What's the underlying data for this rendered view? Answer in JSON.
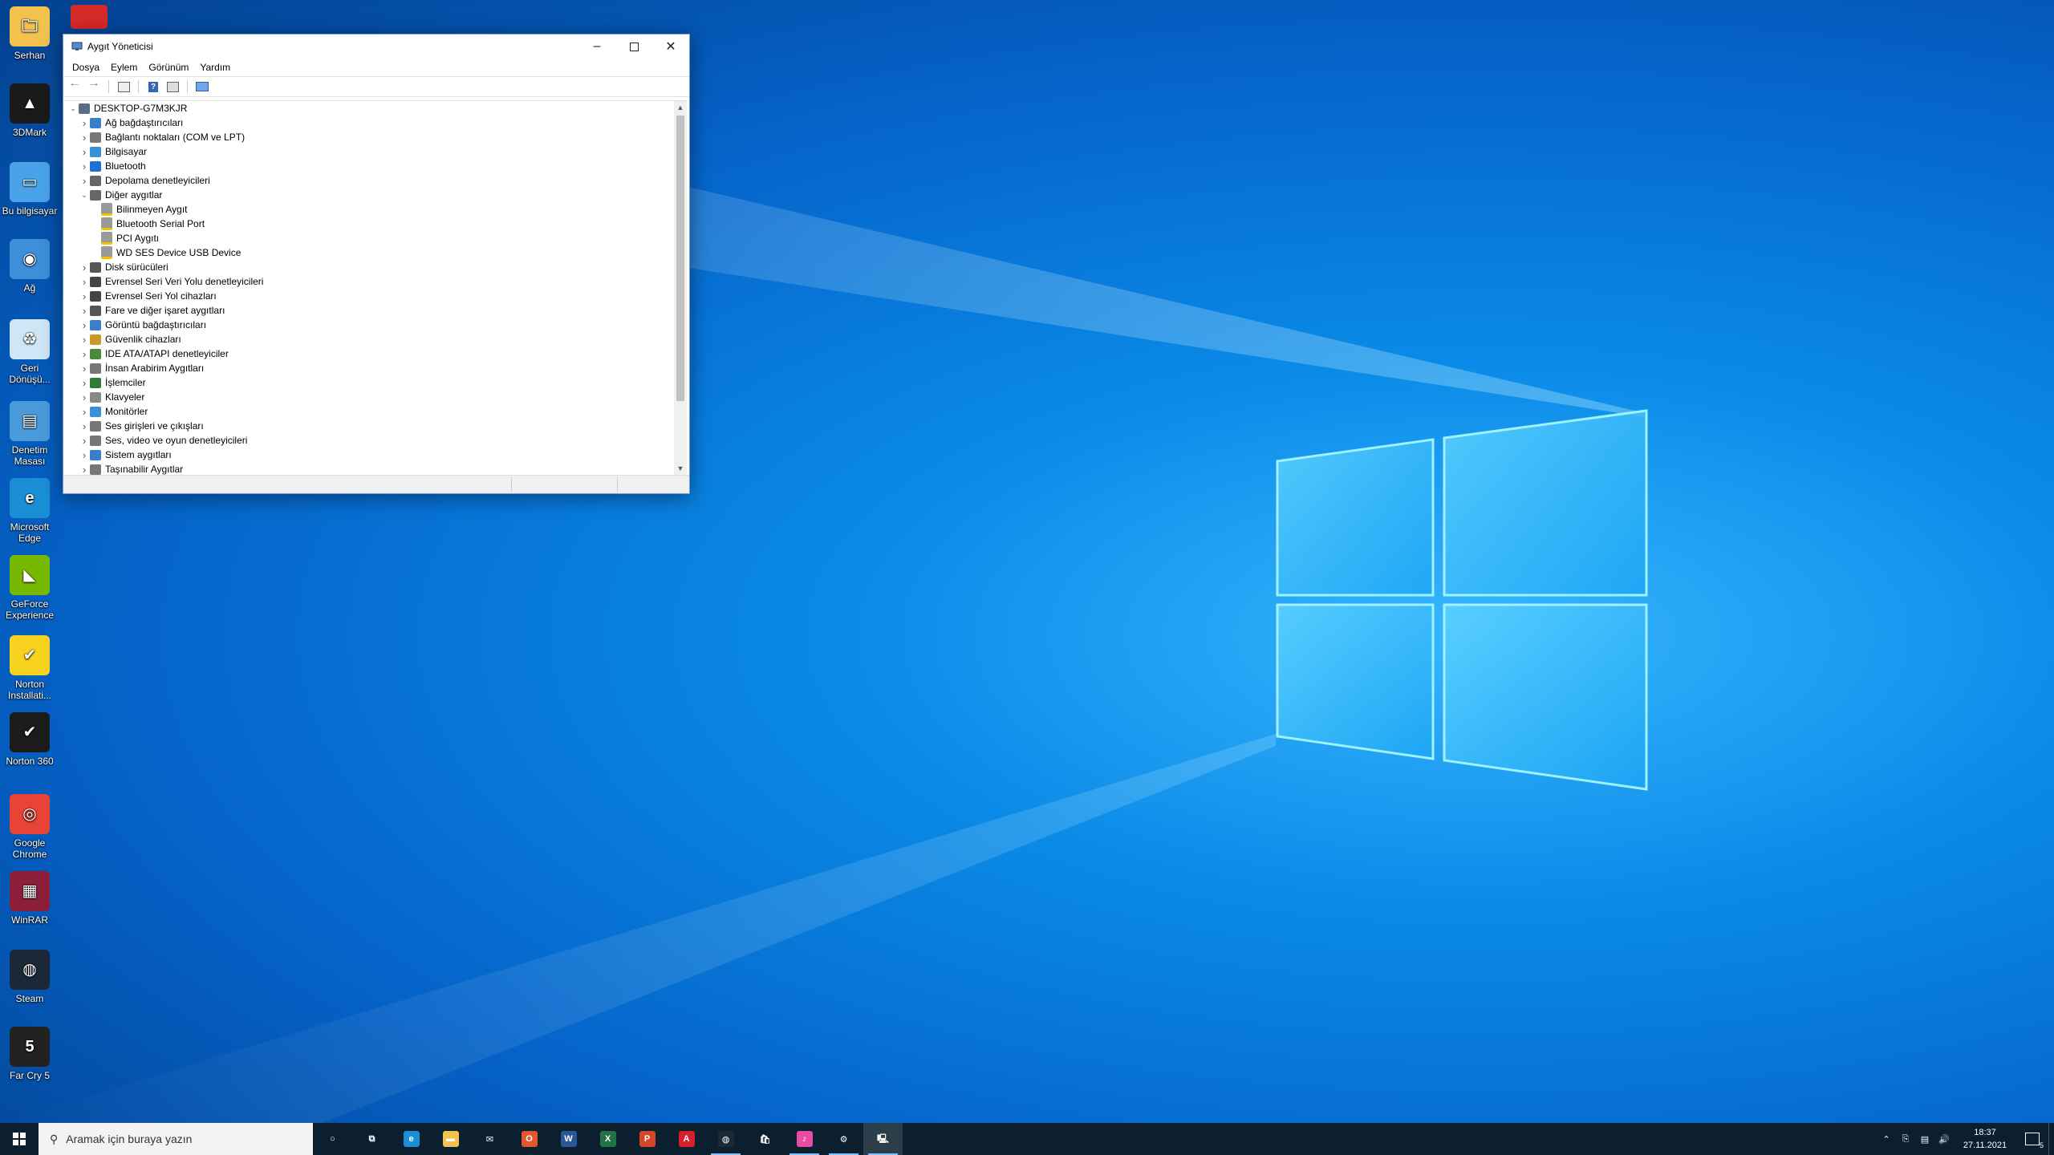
{
  "desktop": {
    "icons": [
      {
        "label": "Serhan",
        "color": "#f2c14e",
        "glyph": "🗀"
      },
      {
        "label": "3DMark",
        "color": "#1a1a1a",
        "glyph": "▲"
      },
      {
        "label": "Bu bilgisayar",
        "color": "#4aa3e8",
        "glyph": "▭"
      },
      {
        "label": "Ağ",
        "color": "#3c8fd8",
        "glyph": "◉"
      },
      {
        "label": "Geri Dönüşü...",
        "color": "#cfe6f7",
        "glyph": "♻"
      },
      {
        "label": "Denetim Masası",
        "color": "#4a9bdc",
        "glyph": "▤"
      },
      {
        "label": "Microsoft Edge",
        "color": "#1a8fd6",
        "glyph": "e"
      },
      {
        "label": "GeForce Experience",
        "color": "#76b900",
        "glyph": "◣"
      },
      {
        "label": "Norton Installati...",
        "color": "#f7d21e",
        "glyph": "✔"
      },
      {
        "label": "Norton 360",
        "color": "#1b1b1b",
        "glyph": "✔"
      },
      {
        "label": "Google Chrome",
        "color": "#e84335",
        "glyph": "◎"
      },
      {
        "label": "WinRAR",
        "color": "#8b1f3a",
        "glyph": "▦"
      },
      {
        "label": "Steam",
        "color": "#1b2838",
        "glyph": "◍"
      },
      {
        "label": "Far Cry 5",
        "color": "#222222",
        "glyph": "5"
      }
    ],
    "partial_icon_color": "#d42a2a"
  },
  "window": {
    "title": "Aygıt Yöneticisi",
    "menu": [
      "Dosya",
      "Eylem",
      "Görünüm",
      "Yardım"
    ],
    "tree": {
      "root": "DESKTOP-G7M3KJR",
      "categories": [
        {
          "label": "Ağ bağdaştırıcıları",
          "expanded": false,
          "icon_color": "#3a7fc9"
        },
        {
          "label": "Bağlantı noktaları (COM ve LPT)",
          "expanded": false,
          "icon_color": "#777777"
        },
        {
          "label": "Bilgisayar",
          "expanded": false,
          "icon_color": "#3a8fd9"
        },
        {
          "label": "Bluetooth",
          "expanded": false,
          "icon_color": "#1e6fd6"
        },
        {
          "label": "Depolama denetleyicileri",
          "expanded": false,
          "icon_color": "#666666"
        },
        {
          "label": "Diğer aygıtlar",
          "expanded": true,
          "icon_color": "#666666",
          "children": [
            "Bilinmeyen Aygıt",
            "Bluetooth Serial Port",
            "PCI Aygıtı",
            "WD SES Device USB Device"
          ]
        },
        {
          "label": "Disk sürücüleri",
          "expanded": false,
          "icon_color": "#555555"
        },
        {
          "label": "Evrensel Seri Veri Yolu denetleyicileri",
          "expanded": false,
          "icon_color": "#444444"
        },
        {
          "label": "Evrensel Seri Yol cihazları",
          "expanded": false,
          "icon_color": "#444444"
        },
        {
          "label": "Fare ve diğer işaret aygıtları",
          "expanded": false,
          "icon_color": "#555555"
        },
        {
          "label": "Görüntü bağdaştırıcıları",
          "expanded": false,
          "icon_color": "#3a7fc9"
        },
        {
          "label": "Güvenlik cihazları",
          "expanded": false,
          "icon_color": "#c79a2b"
        },
        {
          "label": "IDE ATA/ATAPI denetleyiciler",
          "expanded": false,
          "icon_color": "#4a8a3a"
        },
        {
          "label": "İnsan Arabirim Aygıtları",
          "expanded": false,
          "icon_color": "#777777"
        },
        {
          "label": "İşlemciler",
          "expanded": false,
          "icon_color": "#2e7d32"
        },
        {
          "label": "Klavyeler",
          "expanded": false,
          "icon_color": "#888888"
        },
        {
          "label": "Monitörler",
          "expanded": false,
          "icon_color": "#3a8fd9"
        },
        {
          "label": "Ses girişleri ve çıkışları",
          "expanded": false,
          "icon_color": "#777777"
        },
        {
          "label": "Ses, video ve oyun denetleyicileri",
          "expanded": false,
          "icon_color": "#777777"
        },
        {
          "label": "Sistem aygıtları",
          "expanded": false,
          "icon_color": "#3a7fc9"
        },
        {
          "label": "Taşınabilir Aygıtlar",
          "expanded": false,
          "icon_color": "#777777"
        }
      ]
    }
  },
  "taskbar": {
    "search_placeholder": "Aramak için buraya yazın",
    "apps": [
      {
        "name": "cortana",
        "color": "transparent",
        "glyph": "○"
      },
      {
        "name": "task-view",
        "color": "transparent",
        "glyph": "⧉"
      },
      {
        "name": "edge",
        "color": "#1a8fd6",
        "glyph": "e"
      },
      {
        "name": "file-explorer",
        "color": "#f2c14e",
        "glyph": "▬"
      },
      {
        "name": "mail",
        "color": "transparent",
        "glyph": "✉"
      },
      {
        "name": "office",
        "color": "#e4572e",
        "glyph": "O"
      },
      {
        "name": "word",
        "color": "#2b579a",
        "glyph": "W"
      },
      {
        "name": "excel",
        "color": "#217346",
        "glyph": "X"
      },
      {
        "name": "powerpoint",
        "color": "#d24726",
        "glyph": "P"
      },
      {
        "name": "acrobat",
        "color": "#d4202c",
        "glyph": "A"
      },
      {
        "name": "steam",
        "color": "#1b2838",
        "glyph": "◍"
      },
      {
        "name": "store",
        "color": "transparent",
        "glyph": "🛍"
      },
      {
        "name": "itunes",
        "color": "#e94ca0",
        "glyph": "♪"
      },
      {
        "name": "settings",
        "color": "transparent",
        "glyph": "⚙"
      },
      {
        "name": "device-manager",
        "color": "transparent",
        "glyph": "🖳"
      }
    ],
    "time": "18:37",
    "date": "27.11.2021",
    "notification_count": "5"
  }
}
